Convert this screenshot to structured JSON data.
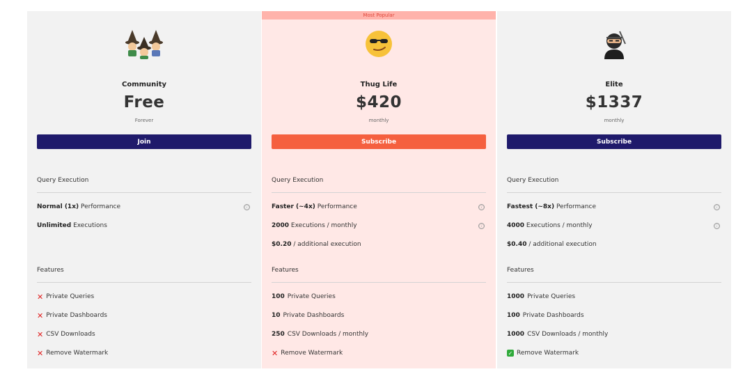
{
  "plans": [
    {
      "emoji": "🧙‍♀️🧙‍♂️🧙",
      "emoji_name": "mage-group-icon",
      "name": "Community",
      "price": "Free",
      "period": "Forever",
      "button": "Join",
      "exec_header": "Query Execution",
      "perf_bold": "Normal (1x)",
      "perf_rest": " Performance",
      "exec_bold": "Unlimited",
      "exec_rest": " Executions",
      "features_header": "Features",
      "features": [
        {
          "num": "",
          "text": "Private Queries",
          "mark": "x"
        },
        {
          "num": "",
          "text": "Private Dashboards",
          "mark": "x"
        },
        {
          "num": "",
          "text": "CSV Downloads",
          "mark": "x"
        },
        {
          "num": "",
          "text": "Remove Watermark",
          "mark": "x"
        }
      ]
    },
    {
      "badge": "Most Popular",
      "emoji": "😏",
      "emoji_name": "smirk-sunglasses-icon",
      "name": "Thug Life",
      "price": "$420",
      "period": "monthly",
      "button": "Subscribe",
      "exec_header": "Query Execution",
      "perf_bold": "Faster (~4x)",
      "perf_rest": " Performance",
      "exec_bold": "2000",
      "exec_rest": " Executions / monthly",
      "add_bold": "$0.20",
      "add_rest": " / additional execution",
      "features_header": "Features",
      "features": [
        {
          "num": "100",
          "text": "Private Queries",
          "mark": ""
        },
        {
          "num": "10",
          "text": "Private Dashboards",
          "mark": ""
        },
        {
          "num": "250",
          "text": "CSV Downloads / monthly",
          "mark": ""
        },
        {
          "num": "",
          "text": "Remove Watermark",
          "mark": "x"
        }
      ]
    },
    {
      "emoji": "🥷",
      "emoji_name": "ninja-icon",
      "name": "Elite",
      "price": "$1337",
      "period": "monthly",
      "button": "Subscribe",
      "exec_header": "Query Execution",
      "perf_bold": "Fastest (~8x)",
      "perf_rest": " Performance",
      "exec_bold": "4000",
      "exec_rest": " Executions / monthly",
      "add_bold": "$0.40",
      "add_rest": " / additional execution",
      "features_header": "Features",
      "features": [
        {
          "num": "1000",
          "text": "Private Queries",
          "mark": ""
        },
        {
          "num": "100",
          "text": "Private Dashboards",
          "mark": ""
        },
        {
          "num": "1000",
          "text": "CSV Downloads / monthly",
          "mark": ""
        },
        {
          "num": "",
          "text": "Remove Watermark",
          "mark": "check"
        }
      ]
    }
  ],
  "info_icon": "ⓘ",
  "colors": {
    "navy": "#1f1a6b",
    "orange": "#f5603f",
    "popular_bg": "#ffe8e6",
    "card_bg": "#f2f2f2"
  }
}
